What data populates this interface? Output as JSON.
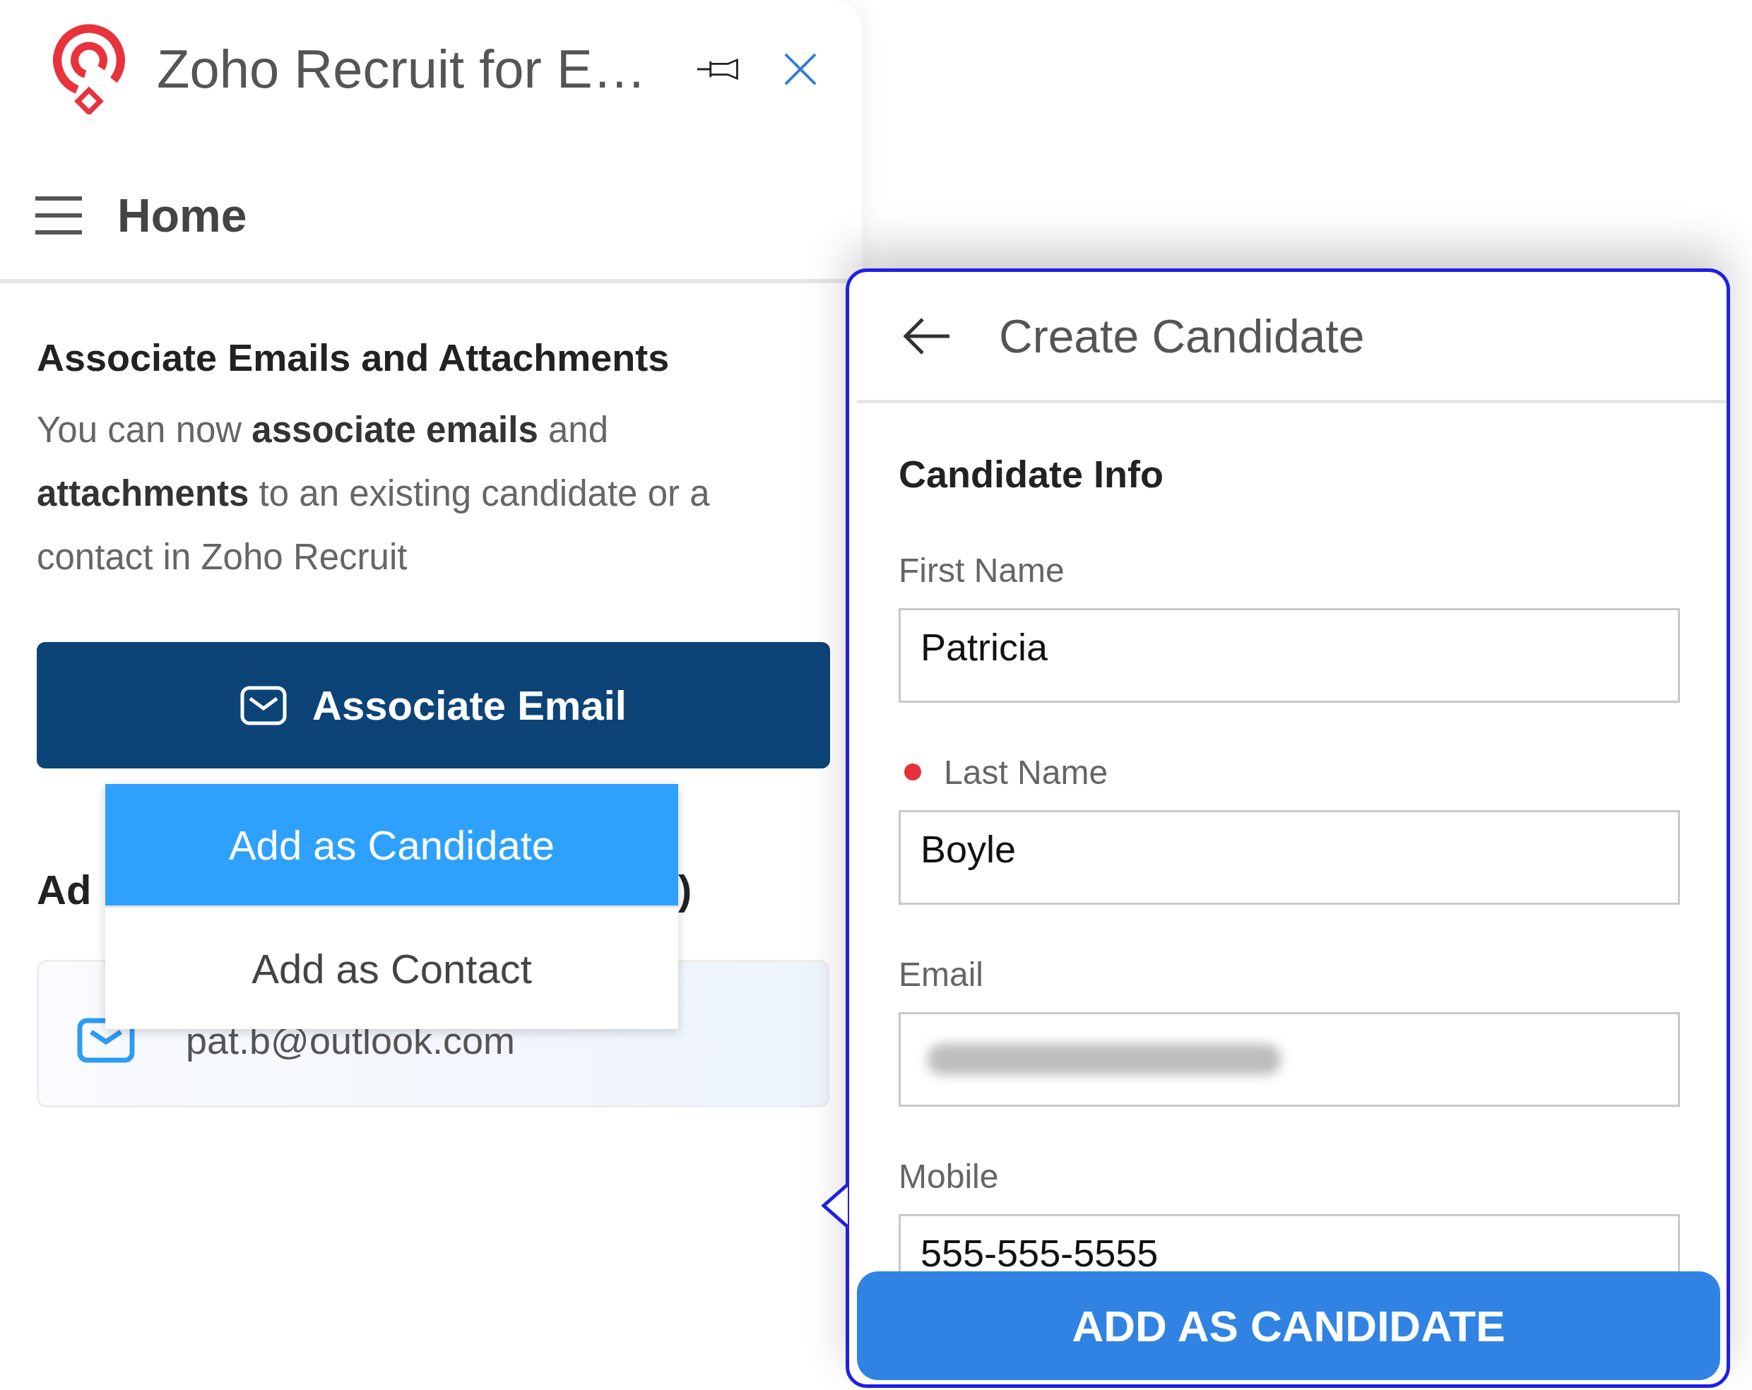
{
  "window": {
    "title": "Zoho Recruit for E…"
  },
  "nav": {
    "title": "Home"
  },
  "associate": {
    "heading": "Associate Emails and Attachments",
    "text": "You can now **associate emails** and **attachments** to an existing candidate or a contact in Zoho Recruit",
    "button": "Associate Email"
  },
  "menu": {
    "items": [
      {
        "label": "Add as Candidate",
        "selected": true
      },
      {
        "label": "Add as Contact",
        "selected": false
      }
    ]
  },
  "add_section": {
    "heading_start": "Ad",
    "heading_end": ")",
    "email": "pat.b@outlook.com"
  },
  "create_candidate": {
    "title": "Create Candidate",
    "section": "Candidate Info",
    "fields": [
      {
        "label": "First Name",
        "value": "Patricia",
        "required": false,
        "redacted": false
      },
      {
        "label": "Last Name",
        "value": "Boyle",
        "required": true,
        "redacted": false
      },
      {
        "label": "Email",
        "required": false,
        "redacted": true
      },
      {
        "label": "Mobile",
        "value": "555-555-5555",
        "required": false,
        "redacted": false
      }
    ],
    "submit": "ADD AS CANDIDATE"
  }
}
